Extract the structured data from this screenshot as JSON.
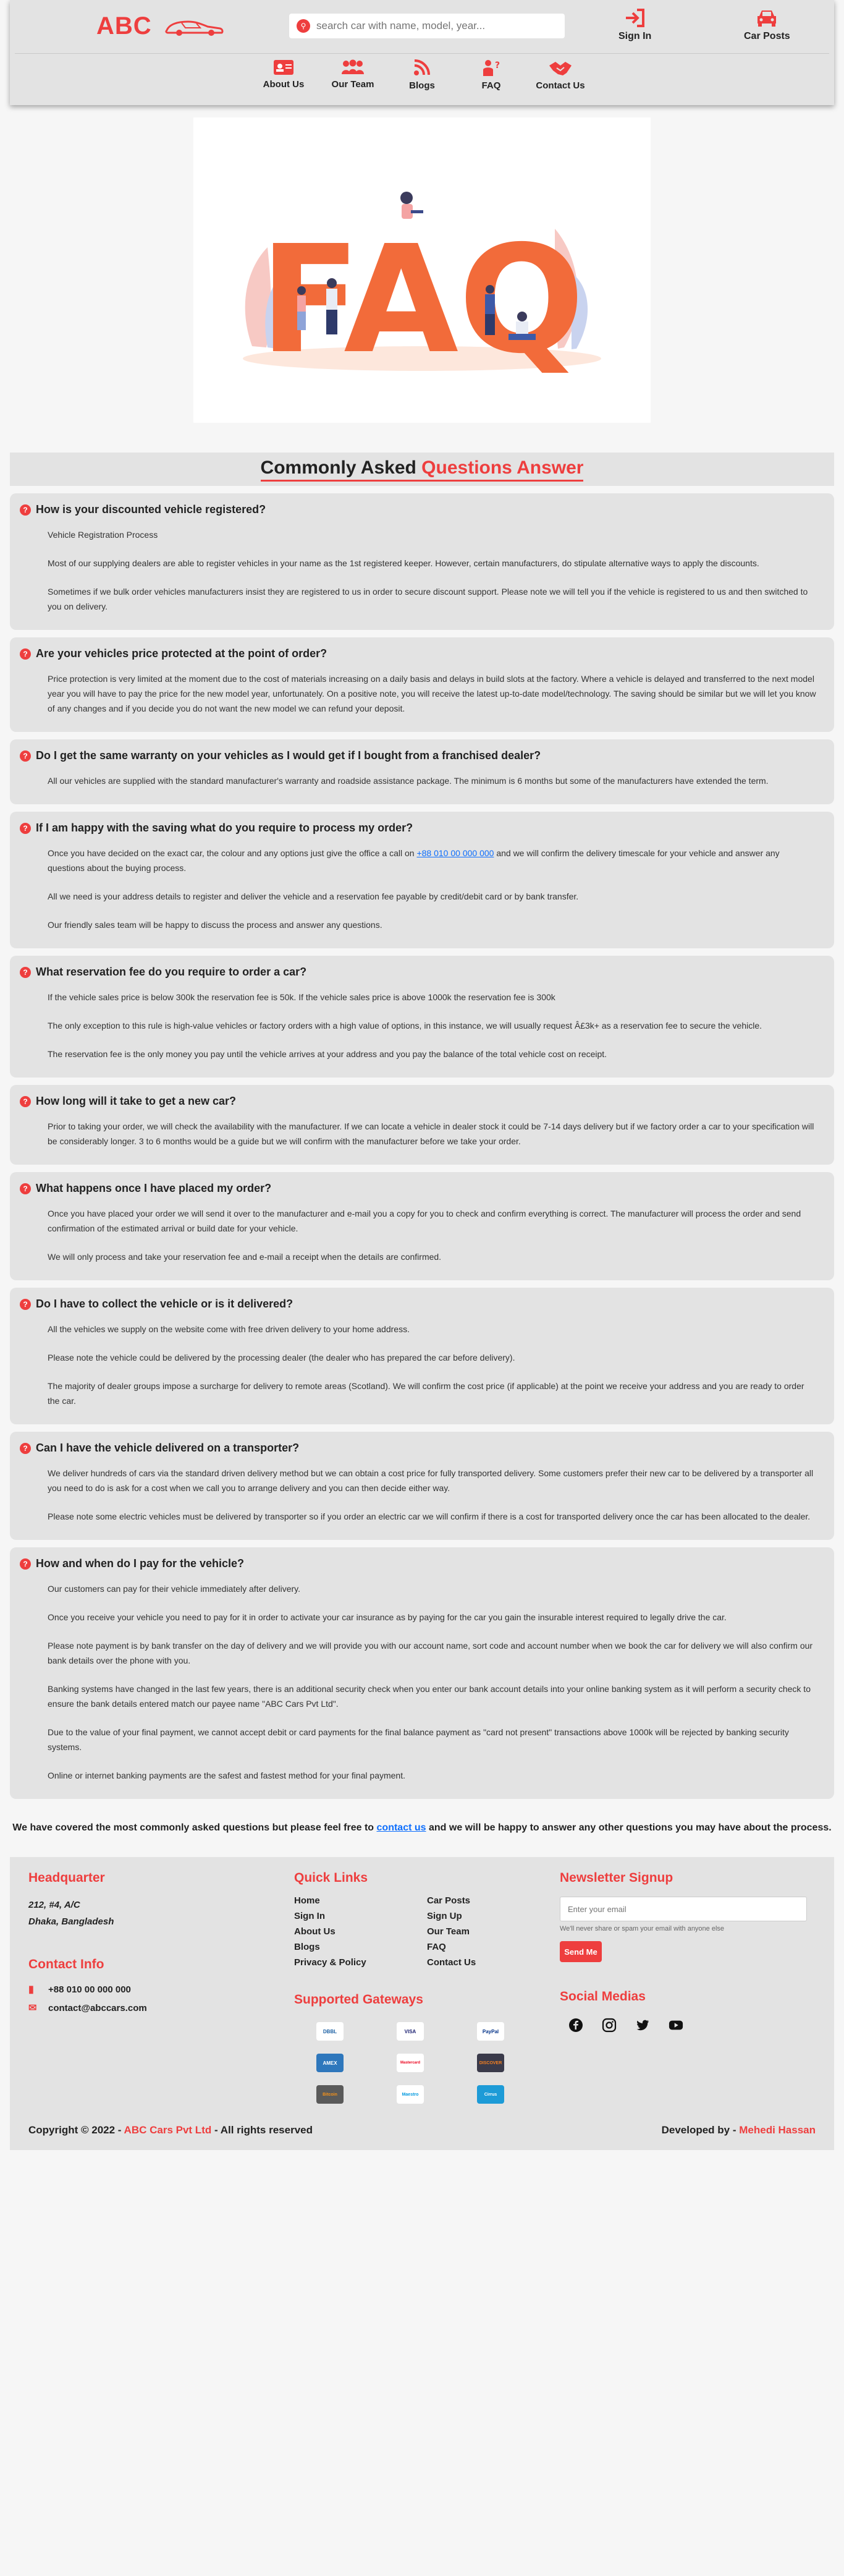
{
  "header": {
    "logo": "ABC",
    "search_placeholder": "search car with name, model, year...",
    "signin": "Sign In",
    "car_posts": "Car Posts"
  },
  "nav": [
    "About Us",
    "Our Team",
    "Blogs",
    "FAQ",
    "Contact Us"
  ],
  "hero": {
    "image_text": "FAQ"
  },
  "section_title": {
    "part1": "Commonly Asked",
    "part2": "Questions Answer"
  },
  "faqs": [
    {
      "q": "How is your discounted vehicle registered?",
      "p": [
        "Vehicle Registration Process",
        "Most of our supplying dealers are able to register vehicles in your name as the 1st registered keeper. However, certain manufacturers, do stipulate alternative ways to apply the discounts.",
        "Sometimes if we bulk order vehicles manufacturers insist they are registered to us in order to secure discount support. Please note we will tell you if the vehicle is registered to us and then switched to you on delivery."
      ]
    },
    {
      "q": "Are your vehicles price protected at the point of order?",
      "p": [
        "Price protection is very limited at the moment due to the cost of materials increasing on a daily basis and delays in build slots at the factory. Where a vehicle is delayed and transferred to the next model year you will have to pay the price for the new model year, unfortunately. On a positive note, you will receive the latest up-to-date model/technology. The saving should be similar but we will let you know of any changes and if you decide you do not want the new model we can refund your deposit."
      ]
    },
    {
      "q": "Do I get the same warranty on your vehicles as I would get if I bought from a franchised dealer?",
      "p": [
        "All our vehicles are supplied with the standard manufacturer's warranty and roadside assistance package. The minimum is 6 months but some of the manufacturers have extended the term."
      ]
    },
    {
      "q": "If I am happy with the saving what do you require to process my order?",
      "p": [
        "All we need is your address details to register and deliver the vehicle and a reservation fee payable by credit/debit card or by bank transfer.",
        "Our friendly sales team will be happy to discuss the process and answer any questions."
      ],
      "p_link": {
        "before": "Once you have decided on the exact car, the colour and any options just give the office a call on ",
        "link": "+88 010 00 000 000",
        "after": " and we will confirm the delivery timescale for your vehicle and answer any questions about the buying process."
      }
    },
    {
      "q": "What reservation fee do you require to order a car?",
      "p": [
        "If the vehicle sales price is below 300k the reservation fee is 50k.  If the vehicle sales price is above 1000k the reservation fee is 300k",
        "The only exception to this rule is high-value vehicles or factory orders with a high value of options, in this instance, we will usually request Â£3k+ as a reservation fee to secure the vehicle.",
        "The reservation fee is the only money you pay until the vehicle arrives at your address and you pay the balance of the total vehicle cost on receipt."
      ]
    },
    {
      "q": "How long will it take to get a new car?",
      "p": [
        "Prior to taking your order, we will check the availability with the manufacturer. If we can locate a vehicle in dealer stock it could be 7-14 days delivery but if we factory order a car to your specification will be considerably longer. 3 to 6 months would be a guide but we will confirm with the manufacturer before we take your order."
      ]
    },
    {
      "q": "What happens once I have placed my order?",
      "p": [
        "Once you have placed your order we will send it over to the manufacturer and e-mail you a copy for you to check and confirm everything is correct. The manufacturer will process the order and send confirmation of the estimated arrival or build date for your vehicle.",
        "We will only process and take your reservation fee and e-mail a receipt when the details are confirmed."
      ]
    },
    {
      "q": "Do I have to collect the vehicle or is it delivered?",
      "p": [
        "All the vehicles we supply on the website come with free driven delivery to your home address.",
        "Please note the vehicle could be delivered by the processing dealer (the dealer who has prepared the car before delivery).",
        "The majority of dealer groups impose a surcharge for delivery to remote areas (Scotland).  We will confirm the cost price (if applicable) at the point we receive your address and you are ready to order the car."
      ]
    },
    {
      "q": "Can I have the vehicle delivered on a transporter?",
      "p": [
        "We deliver hundreds of cars via the standard driven delivery method but we can obtain a cost price for fully transported delivery. Some customers prefer their new car to be delivered by a transporter all you need to do is ask for a cost when we call you to arrange delivery and you can then decide either way.",
        "Please note some electric vehicles must be delivered by transporter so if you order an electric car we will confirm if there is a cost for transported delivery once the car has been allocated to the dealer."
      ]
    },
    {
      "q": "How and when do I pay for the vehicle?",
      "p": [
        "Our customers can pay for their vehicle immediately after delivery.",
        "Once you receive your vehicle you need to pay for it in order to activate your car insurance as by paying for the car you gain the insurable interest required to legally drive the car.",
        "Please note payment is by bank transfer on the day of delivery and we will provide you with our account name, sort code and account number when we book the car for delivery we will also confirm our bank details over the phone with you.",
        "Banking systems have changed in the last few years, there is an additional security check when you enter our bank account details into your online banking system as it will perform a security check to ensure the bank details entered match our payee name \"ABC Cars Pvt Ltd\".",
        "Due to the value of your final payment, we cannot accept debit or card payments for the final balance payment as \"card not present\" transactions above 1000k will be rejected by banking security systems.",
        "Online or internet banking payments are the safest and fastest method for your final payment."
      ]
    }
  ],
  "closing": {
    "before": "We have covered the most commonly asked questions but please feel free to ",
    "link": "contact us",
    "after": " and we will be happy to answer any other questions you may have about the process."
  },
  "footer": {
    "headquarter_title": "Headquarter",
    "address_line1": "212, #4, A/C",
    "address_line2": "Dhaka, Bangladesh",
    "contact_title": "Contact Info",
    "phone": "+88 010 00 000 000",
    "email": "contact@abccars.com",
    "quick_links_title": "Quick Links",
    "quick_links": [
      "Home",
      "Car Posts",
      "Sign In",
      "Sign Up",
      "About Us",
      "Our Team",
      "Blogs",
      "FAQ",
      "Privacy & Policy",
      "Contact Us"
    ],
    "gateways_title": "Supported Gateways",
    "gateways": [
      "DBBL",
      "VISA",
      "PayPal",
      "AMEX",
      "Mastercard",
      "DISCOVER",
      "Bitcoin",
      "Maestro",
      "Cirrus"
    ],
    "newsletter_title": "Newsletter Signup",
    "newsletter_placeholder": "Enter your email",
    "newsletter_note": "We'll never share or spam your email with anyone else",
    "send_label": "Send Me",
    "social_title": "Social Medias",
    "copyright_prefix": "Copyright © 2022 - ",
    "copyright_company": "ABC Cars Pvt Ltd",
    "copyright_suffix": " - All rights reserved",
    "developed_prefix": "Developed by - ",
    "developer": "Mehedi Hassan"
  },
  "colors": {
    "accent": "#ee3e3e",
    "link": "#0d6efd",
    "card_bg": "#e3e3e3"
  }
}
